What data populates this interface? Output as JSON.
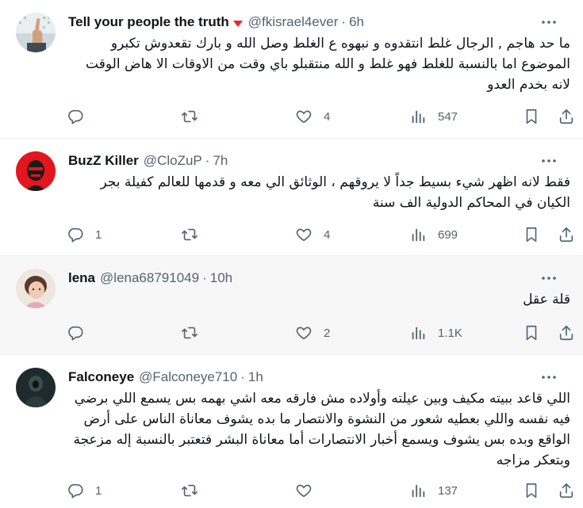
{
  "tweets": [
    {
      "name": "Tell your people the truth",
      "handle": "@fkisrael4ever",
      "time": "6h",
      "text": "ما حد هاجم , الرجال غلط انتقدوه و نبهوه ع الغلط وصل الله و بارك تقعدوش تكبرو الموضوع اما بالنسبة للغلط فهو غلط و الله منتقبلو باي وقت من الاوقات الا هاض الوقت لانه بخدم العدو",
      "replies": "",
      "likes": "4",
      "views": "547"
    },
    {
      "name": "BuzZ Killer",
      "handle": "@CloZuP",
      "time": "7h",
      "text": "فقط لانه اظهر شيء بسيط جداً لا يروقهم ، الوثائق الي معه و قدمها للعالم كفيلة بجر الكيان في المحاكم الدولية الف سنة",
      "replies": "1",
      "likes": "4",
      "views": "699"
    },
    {
      "name": "lena",
      "handle": "@lena68791049",
      "time": "10h",
      "text": "قلة عقل",
      "replies": "",
      "likes": "2",
      "views": "1.1K"
    },
    {
      "name": "Falconeye",
      "handle": "@Falconeye710",
      "time": "1h",
      "text": "اللي قاعد ببيته مكيف وبين عيلته وأولاده مش فارقه معه اشي بهمه بس يسمع اللي برضي فيه نفسه واللي بعطيه شعور من النشوة والانتصار ما بده يشوف معاناة الناس على أرض الواقع وبده بس يشوف ويسمع أخبار الانتصارات أما معاناة البشر فتعتبر بالنسبة إله مزعجة وبتعكر مزاجه",
      "replies": "1",
      "likes": "",
      "views": "137"
    }
  ],
  "colors": {
    "text": "#0f1419",
    "secondary": "#536471",
    "divider": "#eff3f4",
    "badge": "#f4212e"
  },
  "icons": [
    "more-icon",
    "reply-icon",
    "retweet-icon",
    "like-icon",
    "views-icon",
    "bookmark-icon",
    "share-icon"
  ]
}
